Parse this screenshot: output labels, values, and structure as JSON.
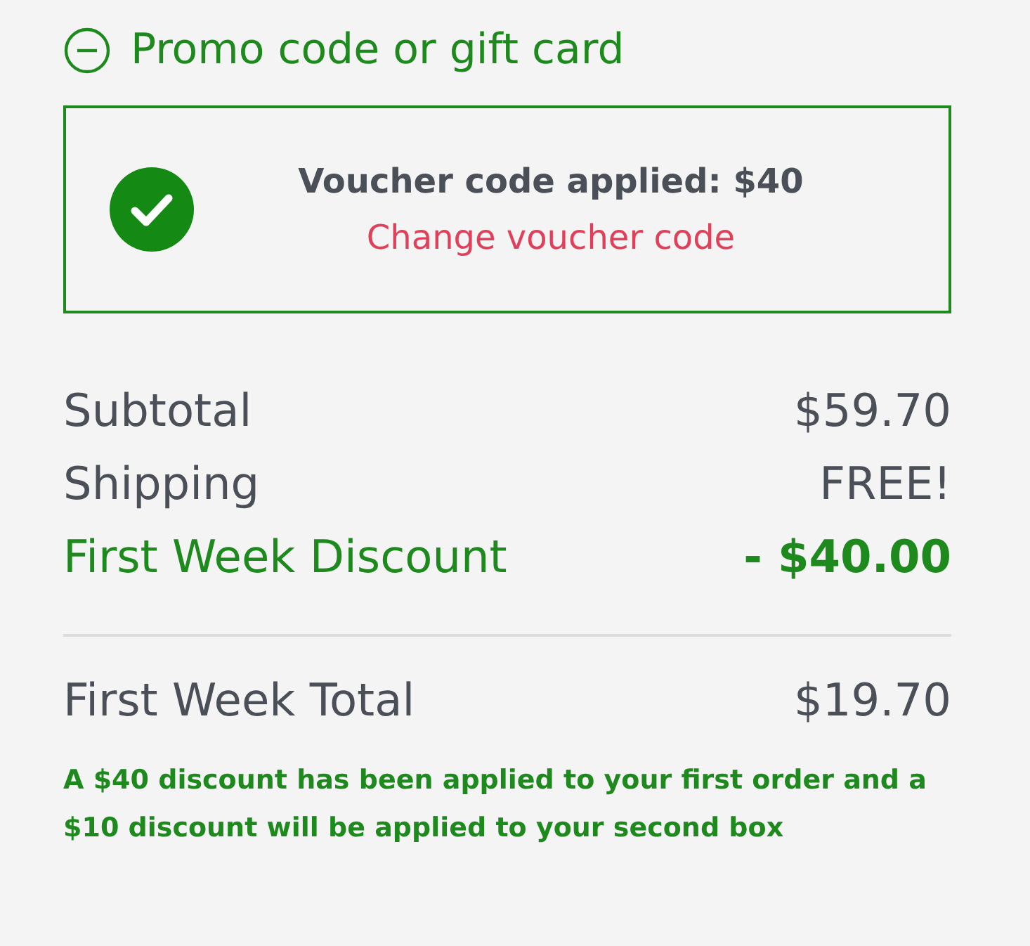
{
  "promo": {
    "label": "Promo code or gift card",
    "expanded": true
  },
  "voucher": {
    "applied": true,
    "message": "Voucher code applied: $40",
    "link": "Change voucher code"
  },
  "summary": [
    {
      "kind": "normal",
      "label": "Subtotal",
      "value": "$59.70"
    },
    {
      "kind": "normal",
      "label": "Shipping",
      "value": "FREE!"
    },
    {
      "kind": "discount",
      "label": "First Week Discount",
      "value": "- $40.00"
    }
  ],
  "total": {
    "label": "First Week Total",
    "value": "$19.70"
  },
  "note": "A $40 discount has been applied to your first order and a $10 discount will be applied to your second box"
}
